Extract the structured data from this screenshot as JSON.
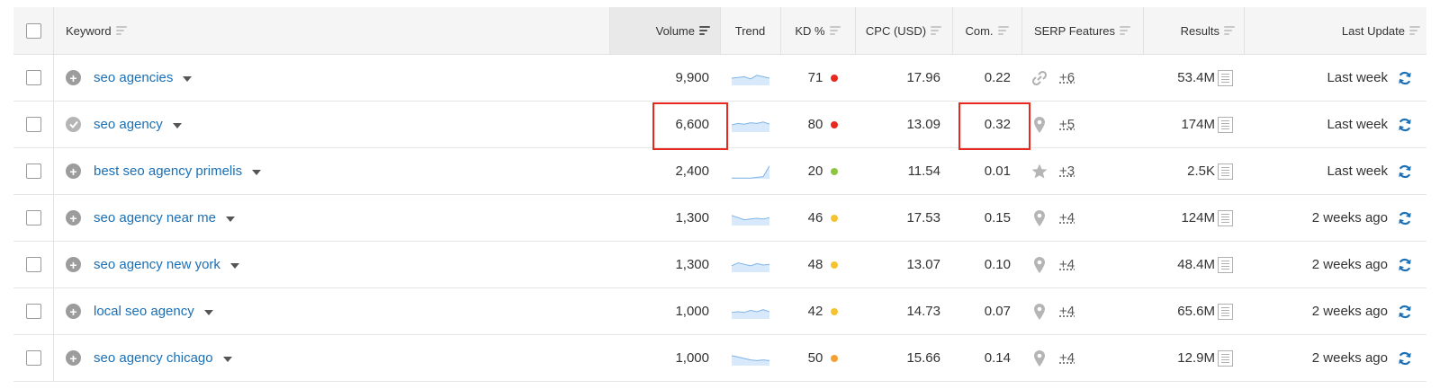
{
  "header": {
    "keyword": "Keyword",
    "volume": "Volume",
    "trend": "Trend",
    "kd": "KD %",
    "cpc": "CPC (USD)",
    "com": "Com.",
    "serp": "SERP Features",
    "results": "Results",
    "last_update": "Last Update"
  },
  "rows": [
    {
      "keyword": "seo agencies",
      "status": "plus",
      "volume": "9,900",
      "trend": [
        0.5,
        0.55,
        0.6,
        0.45,
        0.7,
        0.6,
        0.5
      ],
      "kd": "71",
      "kd_color": "#e8281e",
      "cpc": "17.96",
      "com": "0.22",
      "serp_icon": "link-icon",
      "serp_count": "+6",
      "results": "53.4M",
      "last_update": "Last week"
    },
    {
      "keyword": "seo agency",
      "status": "check",
      "volume": "6,600",
      "trend": [
        0.5,
        0.6,
        0.55,
        0.65,
        0.6,
        0.7,
        0.55
      ],
      "kd": "80",
      "kd_color": "#e8281e",
      "cpc": "13.09",
      "com": "0.32",
      "serp_icon": "map-pin-icon",
      "serp_count": "+5",
      "results": "174M",
      "last_update": "Last week"
    },
    {
      "keyword": "best seo agency primelis",
      "status": "plus",
      "volume": "2,400",
      "trend": [
        0.05,
        0.05,
        0.05,
        0.05,
        0.1,
        0.15,
        0.9
      ],
      "kd": "20",
      "kd_color": "#8cc63f",
      "cpc": "11.54",
      "com": "0.01",
      "serp_icon": "star-icon",
      "serp_count": "+3",
      "results": "2.5K",
      "last_update": "Last week"
    },
    {
      "keyword": "seo agency near me",
      "status": "plus",
      "volume": "1,300",
      "trend": [
        0.7,
        0.55,
        0.4,
        0.45,
        0.5,
        0.45,
        0.55
      ],
      "kd": "46",
      "kd_color": "#f5c330",
      "cpc": "17.53",
      "com": "0.15",
      "serp_icon": "map-pin-icon",
      "serp_count": "+4",
      "results": "124M",
      "last_update": "2 weeks ago"
    },
    {
      "keyword": "seo agency new york",
      "status": "plus",
      "volume": "1,300",
      "trend": [
        0.45,
        0.65,
        0.55,
        0.45,
        0.6,
        0.5,
        0.55
      ],
      "kd": "48",
      "kd_color": "#f5c330",
      "cpc": "13.07",
      "com": "0.10",
      "serp_icon": "map-pin-icon",
      "serp_count": "+4",
      "results": "48.4M",
      "last_update": "2 weeks ago"
    },
    {
      "keyword": "local seo agency",
      "status": "plus",
      "volume": "1,000",
      "trend": [
        0.45,
        0.5,
        0.45,
        0.6,
        0.5,
        0.65,
        0.5
      ],
      "kd": "42",
      "kd_color": "#f5c330",
      "cpc": "14.73",
      "com": "0.07",
      "serp_icon": "map-pin-icon",
      "serp_count": "+4",
      "results": "65.6M",
      "last_update": "2 weeks ago"
    },
    {
      "keyword": "seo agency chicago",
      "status": "plus",
      "volume": "1,000",
      "trend": [
        0.7,
        0.6,
        0.5,
        0.4,
        0.35,
        0.4,
        0.35
      ],
      "kd": "50",
      "kd_color": "#f5a030",
      "cpc": "15.66",
      "com": "0.14",
      "serp_icon": "map-pin-icon",
      "serp_count": "+4",
      "results": "12.9M",
      "last_update": "2 weeks ago"
    }
  ],
  "colors": {
    "link": "#1a6fb5",
    "highlight": "#e8281e",
    "trend_fill": "#d7e9fb",
    "trend_line": "#7fb3e6",
    "refresh": "#1a6fb5"
  },
  "highlights": [
    "volume-row-2",
    "com-row-2"
  ]
}
